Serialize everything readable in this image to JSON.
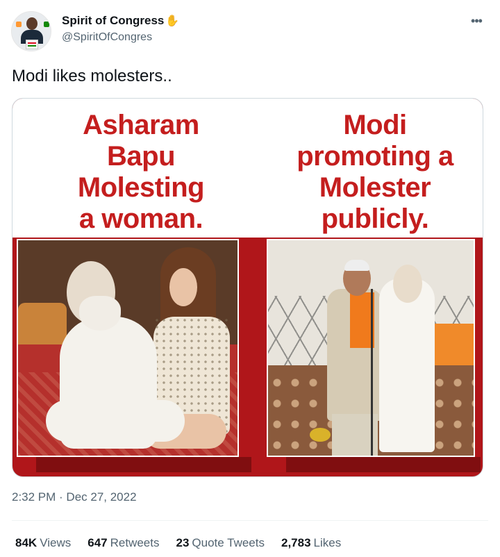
{
  "author": {
    "display_name": "Spirit of Congress",
    "emoji": "✋",
    "handle": "@SpiritOfCongres"
  },
  "more_icon": "more-horizontal-icon",
  "tweet_text": "Modi likes molesters..",
  "media": {
    "left_caption": [
      "Asharam",
      "Bapu",
      "Molesting",
      "a woman."
    ],
    "right_caption": [
      "Modi",
      "promoting a",
      "Molester",
      "publicly."
    ]
  },
  "timestamp": "2:32 PM · Dec 27, 2022",
  "stats": {
    "views_count": "84K",
    "views_label": "Views",
    "retweets_count": "647",
    "retweets_label": "Retweets",
    "quotes_count": "23",
    "quotes_label": "Quote Tweets",
    "likes_count": "2,783",
    "likes_label": "Likes"
  },
  "colors": {
    "caption_red": "#c41e1e",
    "banner_red": "#b0161a",
    "secondary_text": "#536471"
  }
}
